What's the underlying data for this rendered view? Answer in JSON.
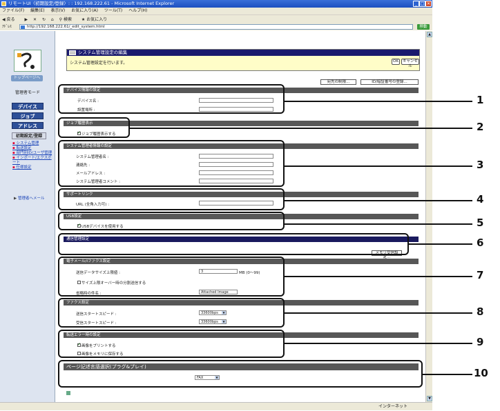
{
  "window": {
    "title": "リモートUI〈初期設定/登録〉: : 192.168.222.61 - Microsoft Internet Explorer",
    "controls": [
      "_",
      "□",
      "✕"
    ]
  },
  "menubar": [
    "ファイル(F)",
    "編集(E)",
    "表示(V)",
    "お気に入り(A)",
    "ツール(T)",
    "ヘルプ(H)"
  ],
  "toolbar": {
    "back": "戻る",
    "search": "検索",
    "favorites": "お気に入り"
  },
  "address": {
    "url": "http://192.168.222.61/_edit_system.html",
    "go": "移動"
  },
  "sidebar": {
    "top_page": "トップページへ",
    "mode": "管理者モード",
    "nav": [
      "デバイス",
      "ジョブ",
      "アドレス"
    ],
    "nav_active": "初期設定/登録",
    "links": [
      "システム管理",
      "転送設定",
      "部門別ID/ユーザ管理",
      "インポート/エクスポート",
      "仕様設定"
    ],
    "admin_link": "管理者へメール"
  },
  "header": {
    "title": "システム管理設定の編集",
    "desc": "システム管理設定を行います。",
    "ok": "OK",
    "cancel": "キャンセル"
  },
  "buttons": {
    "dest_limit": "宛先の制限...",
    "id_register": "ID/暗証番号の登録...",
    "mem_receive": "メモリ受信設定..."
  },
  "sections": {
    "device": {
      "title": "デバイス情報の設定",
      "fields": [
        "デバイス名 :",
        "設置場所 :"
      ]
    },
    "job": {
      "title": "ジョブ履歴表示",
      "check": "ジョブ履歴表示する"
    },
    "admin": {
      "title": "システム管理者情報の設定",
      "fields": [
        "システム管理者名 :",
        "連絡先 :",
        "メールアドレス :",
        "システム管理者コメント :"
      ]
    },
    "support": {
      "title": "サポートリンク",
      "field": "URL (全角入力可) :"
    },
    "usb": {
      "title": "USB設定",
      "check": "USBデバイスを使用する"
    },
    "comm": {
      "title": "通信管理設定"
    },
    "email": {
      "title": "電子メール/Iファクス設定",
      "size_label": "送信データサイズ上限値 :",
      "size_value": "3",
      "size_unit": "MB (0〜99)",
      "split_check": "サイズ上限オーバー時の分割送信する",
      "subject_label": "省略時の件名 :",
      "subject_value": "Attached Image"
    },
    "fax": {
      "title": "ファクス設定",
      "tx_label": "送信スタートスピード :",
      "tx_value": "33600bps",
      "rx_label": "受信スタートスピード :",
      "rx_value": "33600bps"
    },
    "error": {
      "title": "転送エラー時の設定",
      "print_check": "画像をプリントする",
      "save_check": "画像をメモリに保存する"
    },
    "pdl": {
      "title": "ページ記述言語選択(プラグ&プレイ)",
      "value": "FAX"
    }
  },
  "callouts": [
    "1",
    "2",
    "3",
    "4",
    "5",
    "6",
    "7",
    "8",
    "9",
    "10"
  ],
  "status": {
    "zone": "インターネット"
  }
}
